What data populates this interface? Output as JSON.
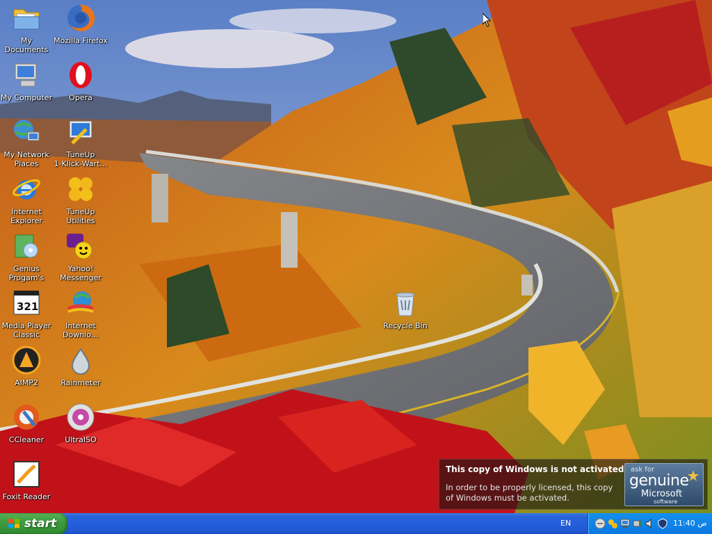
{
  "desktop": {
    "icons": [
      {
        "label": "My Documents",
        "icon": "folder-documents-icon"
      },
      {
        "label": "Mozilla Firefox",
        "icon": "firefox-icon"
      },
      {
        "label": "My Computer",
        "icon": "computer-icon"
      },
      {
        "label": "Opera",
        "icon": "opera-icon"
      },
      {
        "label": "My Network\nPlaces",
        "icon": "network-places-icon"
      },
      {
        "label": "TuneUp\n1-Klick-Wart…",
        "icon": "tuneup-maintenance-icon"
      },
      {
        "label": "Internet\nExplorer",
        "icon": "internet-explorer-icon"
      },
      {
        "label": "TuneUp Utilities",
        "icon": "tuneup-utilities-icon"
      },
      {
        "label": "Genius\nProgam's",
        "icon": "genius-programs-icon"
      },
      {
        "label": "Yahoo!\nMessenger",
        "icon": "yahoo-messenger-icon"
      },
      {
        "label": "Media Player\nClassic",
        "icon": "media-player-classic-icon"
      },
      {
        "label": "Internet\nDownlo…",
        "icon": "internet-download-manager-icon"
      },
      {
        "label": "AIMP2",
        "icon": "aimp2-icon"
      },
      {
        "label": "Rainmeter",
        "icon": "rainmeter-icon"
      },
      {
        "label": "CCleaner",
        "icon": "ccleaner-icon"
      },
      {
        "label": "UltraISO",
        "icon": "ultraiso-icon"
      },
      {
        "label": "Foxit Reader",
        "icon": "foxit-reader-icon"
      },
      {
        "label": "Recycle Bin",
        "icon": "recycle-bin-icon"
      }
    ]
  },
  "activation": {
    "title": "This copy of Windows is not activated.",
    "body": "In order to be properly licensed, this copy of Windows must be activated.",
    "badge": {
      "ask_for": "ask for",
      "genuine": "genuine",
      "microsoft": "Microsoft",
      "software": "software"
    }
  },
  "taskbar": {
    "start_label": "start",
    "language": "EN",
    "clock": "11:40 ص",
    "tray_icons": [
      "messenger-tray-icon",
      "idm-tray-icon",
      "network-tray-icon",
      "safely-remove-tray-icon",
      "volume-tray-icon",
      "shield-tray-icon",
      "star-tray-icon"
    ]
  },
  "colors": {
    "taskbar_blue": "#245edc",
    "start_green": "#3d9b3d",
    "tray_blue": "#1390ee"
  }
}
